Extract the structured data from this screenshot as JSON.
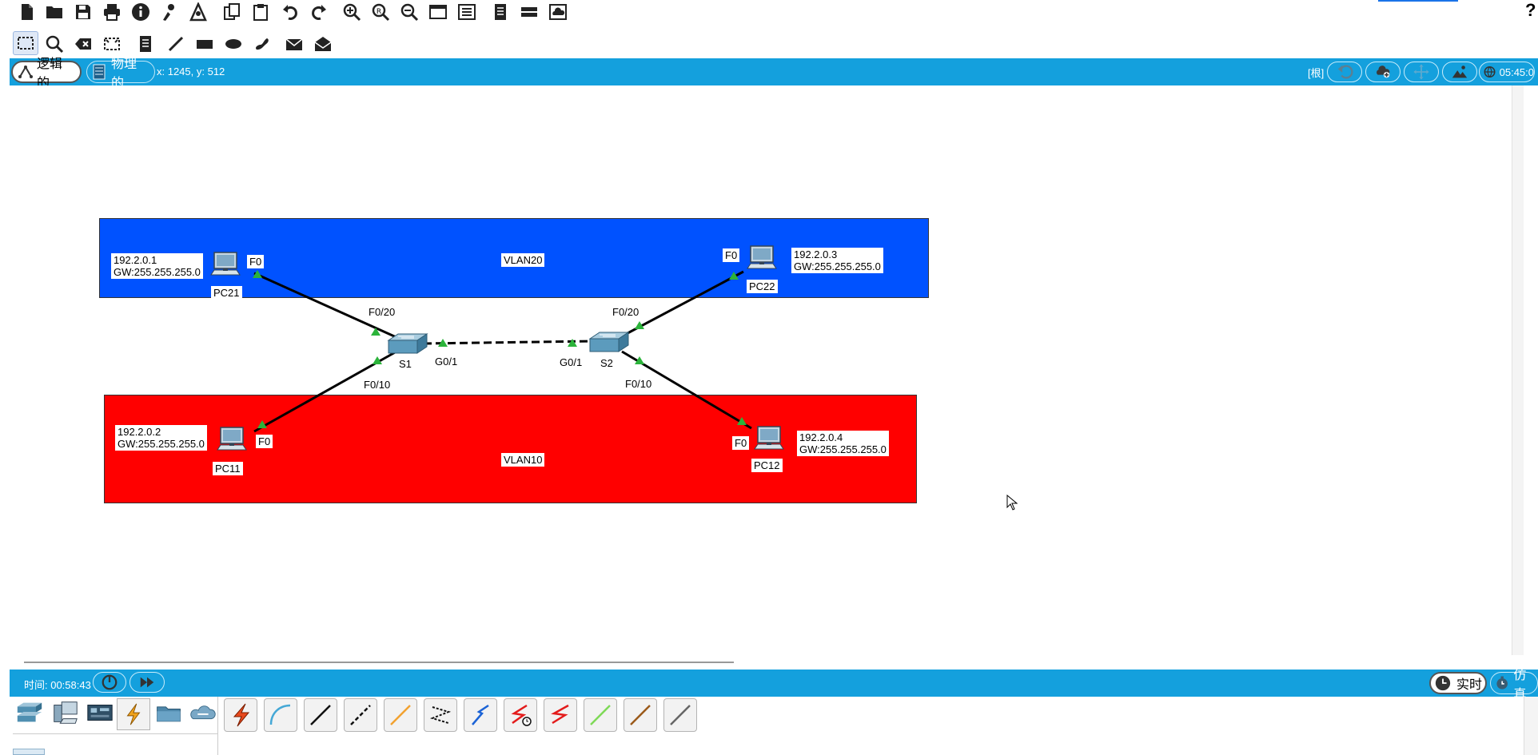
{
  "status": {
    "coordinates": "x: 1245, y: 512",
    "root_label": "[根]",
    "clock": "05:45:0"
  },
  "tabs": {
    "logical": "逻辑的",
    "physical": "物理的"
  },
  "help_label": "?",
  "workspace": {
    "vlan20": {
      "label": "VLAN20",
      "color": "#0052ff"
    },
    "vlan10": {
      "label": "VLAN10",
      "color": "#ff0000"
    },
    "devices": {
      "pc21": {
        "name": "PC21",
        "ip": "192.2.0.1",
        "gw": "GW:255.255.255.0",
        "port": "F0"
      },
      "pc22": {
        "name": "PC22",
        "ip": "192.2.0.3",
        "gw": "GW:255.255.255.0",
        "port": "F0"
      },
      "pc11": {
        "name": "PC11",
        "ip": "192.2.0.2",
        "gw": "GW:255.255.255.0",
        "port": "F0"
      },
      "pc12": {
        "name": "PC12",
        "ip": "192.2.0.4",
        "gw": "GW:255.255.255.0",
        "port": "F0"
      },
      "s1": {
        "name": "S1",
        "port_up": "F0/20",
        "port_down": "F0/10",
        "port_trunk": "G0/1"
      },
      "s2": {
        "name": "S2",
        "port_up": "F0/20",
        "port_down": "F0/10",
        "port_trunk": "G0/1"
      }
    },
    "link_light_color": "#2bb33a"
  },
  "bottom": {
    "time_label": "时间: 00:58:43",
    "realtime_label": "实时",
    "simulation_label": "仿真"
  },
  "device_categories": [
    "network-devices",
    "end-devices",
    "components",
    "connections",
    "miscellaneous",
    "multiuser"
  ],
  "cables": [
    "auto-connect",
    "console",
    "copper-straight-through",
    "copper-cross-over",
    "fiber",
    "phone",
    "coaxial",
    "serial-dce",
    "serial-dte",
    "octal",
    "iot-custom",
    "usb"
  ]
}
